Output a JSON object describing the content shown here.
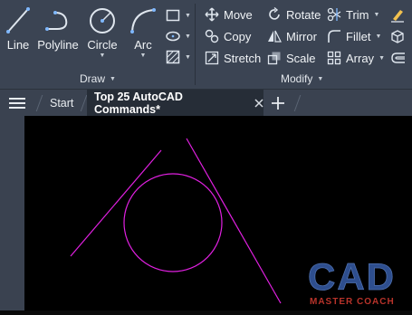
{
  "colors": {
    "ribbon_bg": "#3b4453",
    "canvas_bg": "#000000",
    "accent_icon": "#7fb8ff",
    "drawing_magenta": "#ff00ff",
    "watermark_blue": "#2f4f8f",
    "watermark_red": "#c0392b"
  },
  "ribbon": {
    "draw_panel": {
      "title": "Draw",
      "tools": [
        {
          "label": "Line",
          "icon": "line-icon"
        },
        {
          "label": "Polyline",
          "icon": "polyline-icon"
        },
        {
          "label": "Circle",
          "icon": "circle-icon"
        },
        {
          "label": "Arc",
          "icon": "arc-icon"
        }
      ],
      "small_tools": [
        {
          "icon": "rectangle-icon"
        },
        {
          "icon": "ellipse-icon"
        },
        {
          "icon": "hatch-icon"
        }
      ]
    },
    "modify_panel": {
      "title": "Modify",
      "tools": [
        {
          "label": "Move",
          "icon": "move-icon"
        },
        {
          "label": "Rotate",
          "icon": "rotate-icon"
        },
        {
          "label": "Trim",
          "icon": "trim-icon"
        },
        {
          "label": "Copy",
          "icon": "copy-icon"
        },
        {
          "label": "Mirror",
          "icon": "mirror-icon"
        },
        {
          "label": "Fillet",
          "icon": "fillet-icon"
        },
        {
          "label": "Stretch",
          "icon": "stretch-icon"
        },
        {
          "label": "Scale",
          "icon": "scale-icon"
        },
        {
          "label": "Array",
          "icon": "array-icon"
        }
      ],
      "extra_icons": [
        "erase-icon",
        "explode-icon",
        "offset-icon"
      ]
    }
  },
  "tabs": {
    "menu_icon": "hamburger-icon",
    "start_label": "Start",
    "active_label": "Top 25 AutoCAD Commands*",
    "close_icon": "close-icon",
    "new_tab_icon": "plus-icon"
  },
  "watermark": {
    "text": "CAD",
    "subtext": "MASTER COACH"
  }
}
